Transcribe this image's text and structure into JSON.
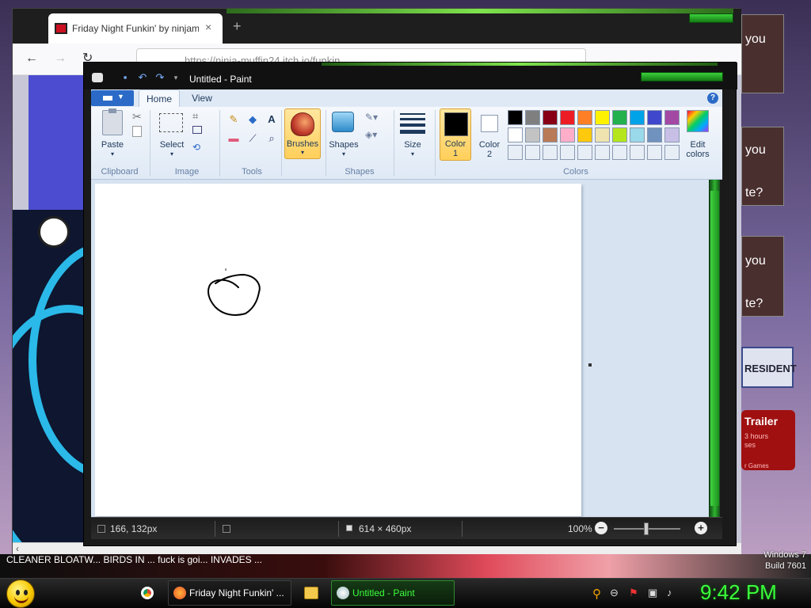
{
  "browser": {
    "tab_title": "Friday Night Funkin' by ninjam",
    "tab_close": "×",
    "new_tab": "+",
    "back": "←",
    "forward": "→",
    "reload": "↻",
    "url": "https://ninja-muffin24.itch.io/funkin",
    "scroll_left": "‹"
  },
  "ads": {
    "you1": "you",
    "you2": "you",
    "you2b": "te?",
    "you3": "you",
    "you3b": "te?",
    "president": "RESIDENT",
    "trailer_title": "Trailer",
    "trailer_sub": "3 hours",
    "trailer_sub2": "ses",
    "trailer_sub3": "r Games"
  },
  "desktop": {
    "strip_text": "CLEANER    BLOATW...   BIRDS IN ...   fuck is goi...  INVADES ...",
    "windows_line1": "Windows 7",
    "windows_line2": "Build 7601"
  },
  "paint": {
    "title": "Untitled - Paint",
    "tabs": [
      "Home",
      "View"
    ],
    "help": "?",
    "groups": {
      "clipboard": "Clipboard",
      "image": "Image",
      "tools": "Tools",
      "shapes": "Shapes",
      "colors": "Colors"
    },
    "buttons": {
      "paste": "Paste",
      "select": "Select",
      "brushes": "Brushes",
      "shapes": "Shapes",
      "size": "Size",
      "color1_line1": "Color",
      "color1_line2": "1",
      "color2_line1": "Color",
      "color2_line2": "2",
      "edit_colors_line1": "Edit",
      "edit_colors_line2": "colors"
    },
    "palette_row1": [
      "#000000",
      "#7f7f7f",
      "#880015",
      "#ed1c24",
      "#ff7f27",
      "#fff200",
      "#22b14c",
      "#00a2e8",
      "#3f48cc",
      "#a349a4"
    ],
    "palette_row2": [
      "#ffffff",
      "#c3c3c3",
      "#b97a57",
      "#ffaec9",
      "#ffc90e",
      "#efe4b0",
      "#b5e61d",
      "#99d9ea",
      "#7092be",
      "#c8bfe7"
    ],
    "palette_row3": [
      "#e8eef6",
      "#e8eef6",
      "#e8eef6",
      "#e8eef6",
      "#e8eef6",
      "#e8eef6",
      "#e8eef6",
      "#e8eef6",
      "#e8eef6",
      "#e8eef6"
    ],
    "color1": "#000000",
    "color2": "#ffffff",
    "status": {
      "cursor_pos": "166, 132px",
      "canvas_size": "614 × 460px",
      "zoom": "100%",
      "zoom_out": "−",
      "zoom_in": "+"
    }
  },
  "taskbar": {
    "firefox_label": "Friday Night Funkin' ...",
    "paint_label": "Untitled - Paint",
    "clock": "9:42 PM"
  }
}
